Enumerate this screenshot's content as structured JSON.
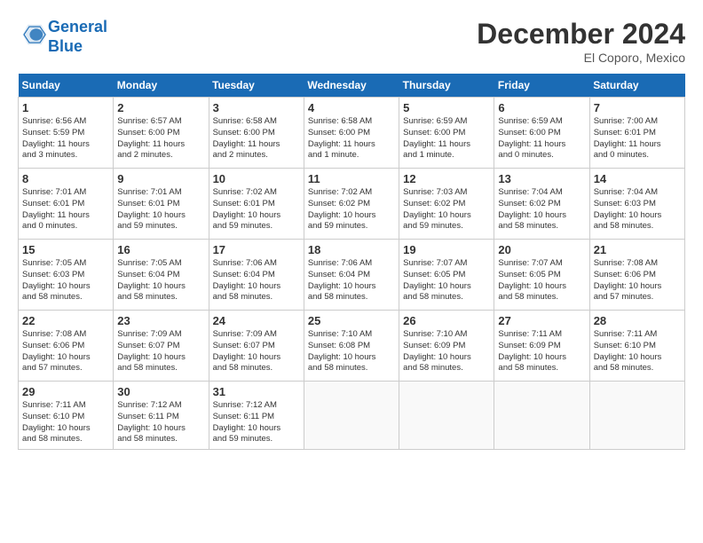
{
  "header": {
    "logo_line1": "General",
    "logo_line2": "Blue",
    "month": "December 2024",
    "location": "El Coporo, Mexico"
  },
  "weekdays": [
    "Sunday",
    "Monday",
    "Tuesday",
    "Wednesday",
    "Thursday",
    "Friday",
    "Saturday"
  ],
  "weeks": [
    [
      {
        "day": "1",
        "lines": [
          "Sunrise: 6:56 AM",
          "Sunset: 5:59 PM",
          "Daylight: 11 hours",
          "and 3 minutes."
        ]
      },
      {
        "day": "2",
        "lines": [
          "Sunrise: 6:57 AM",
          "Sunset: 6:00 PM",
          "Daylight: 11 hours",
          "and 2 minutes."
        ]
      },
      {
        "day": "3",
        "lines": [
          "Sunrise: 6:58 AM",
          "Sunset: 6:00 PM",
          "Daylight: 11 hours",
          "and 2 minutes."
        ]
      },
      {
        "day": "4",
        "lines": [
          "Sunrise: 6:58 AM",
          "Sunset: 6:00 PM",
          "Daylight: 11 hours",
          "and 1 minute."
        ]
      },
      {
        "day": "5",
        "lines": [
          "Sunrise: 6:59 AM",
          "Sunset: 6:00 PM",
          "Daylight: 11 hours",
          "and 1 minute."
        ]
      },
      {
        "day": "6",
        "lines": [
          "Sunrise: 6:59 AM",
          "Sunset: 6:00 PM",
          "Daylight: 11 hours",
          "and 0 minutes."
        ]
      },
      {
        "day": "7",
        "lines": [
          "Sunrise: 7:00 AM",
          "Sunset: 6:01 PM",
          "Daylight: 11 hours",
          "and 0 minutes."
        ]
      }
    ],
    [
      {
        "day": "8",
        "lines": [
          "Sunrise: 7:01 AM",
          "Sunset: 6:01 PM",
          "Daylight: 11 hours",
          "and 0 minutes."
        ]
      },
      {
        "day": "9",
        "lines": [
          "Sunrise: 7:01 AM",
          "Sunset: 6:01 PM",
          "Daylight: 10 hours",
          "and 59 minutes."
        ]
      },
      {
        "day": "10",
        "lines": [
          "Sunrise: 7:02 AM",
          "Sunset: 6:01 PM",
          "Daylight: 10 hours",
          "and 59 minutes."
        ]
      },
      {
        "day": "11",
        "lines": [
          "Sunrise: 7:02 AM",
          "Sunset: 6:02 PM",
          "Daylight: 10 hours",
          "and 59 minutes."
        ]
      },
      {
        "day": "12",
        "lines": [
          "Sunrise: 7:03 AM",
          "Sunset: 6:02 PM",
          "Daylight: 10 hours",
          "and 59 minutes."
        ]
      },
      {
        "day": "13",
        "lines": [
          "Sunrise: 7:04 AM",
          "Sunset: 6:02 PM",
          "Daylight: 10 hours",
          "and 58 minutes."
        ]
      },
      {
        "day": "14",
        "lines": [
          "Sunrise: 7:04 AM",
          "Sunset: 6:03 PM",
          "Daylight: 10 hours",
          "and 58 minutes."
        ]
      }
    ],
    [
      {
        "day": "15",
        "lines": [
          "Sunrise: 7:05 AM",
          "Sunset: 6:03 PM",
          "Daylight: 10 hours",
          "and 58 minutes."
        ]
      },
      {
        "day": "16",
        "lines": [
          "Sunrise: 7:05 AM",
          "Sunset: 6:04 PM",
          "Daylight: 10 hours",
          "and 58 minutes."
        ]
      },
      {
        "day": "17",
        "lines": [
          "Sunrise: 7:06 AM",
          "Sunset: 6:04 PM",
          "Daylight: 10 hours",
          "and 58 minutes."
        ]
      },
      {
        "day": "18",
        "lines": [
          "Sunrise: 7:06 AM",
          "Sunset: 6:04 PM",
          "Daylight: 10 hours",
          "and 58 minutes."
        ]
      },
      {
        "day": "19",
        "lines": [
          "Sunrise: 7:07 AM",
          "Sunset: 6:05 PM",
          "Daylight: 10 hours",
          "and 58 minutes."
        ]
      },
      {
        "day": "20",
        "lines": [
          "Sunrise: 7:07 AM",
          "Sunset: 6:05 PM",
          "Daylight: 10 hours",
          "and 58 minutes."
        ]
      },
      {
        "day": "21",
        "lines": [
          "Sunrise: 7:08 AM",
          "Sunset: 6:06 PM",
          "Daylight: 10 hours",
          "and 57 minutes."
        ]
      }
    ],
    [
      {
        "day": "22",
        "lines": [
          "Sunrise: 7:08 AM",
          "Sunset: 6:06 PM",
          "Daylight: 10 hours",
          "and 57 minutes."
        ]
      },
      {
        "day": "23",
        "lines": [
          "Sunrise: 7:09 AM",
          "Sunset: 6:07 PM",
          "Daylight: 10 hours",
          "and 58 minutes."
        ]
      },
      {
        "day": "24",
        "lines": [
          "Sunrise: 7:09 AM",
          "Sunset: 6:07 PM",
          "Daylight: 10 hours",
          "and 58 minutes."
        ]
      },
      {
        "day": "25",
        "lines": [
          "Sunrise: 7:10 AM",
          "Sunset: 6:08 PM",
          "Daylight: 10 hours",
          "and 58 minutes."
        ]
      },
      {
        "day": "26",
        "lines": [
          "Sunrise: 7:10 AM",
          "Sunset: 6:09 PM",
          "Daylight: 10 hours",
          "and 58 minutes."
        ]
      },
      {
        "day": "27",
        "lines": [
          "Sunrise: 7:11 AM",
          "Sunset: 6:09 PM",
          "Daylight: 10 hours",
          "and 58 minutes."
        ]
      },
      {
        "day": "28",
        "lines": [
          "Sunrise: 7:11 AM",
          "Sunset: 6:10 PM",
          "Daylight: 10 hours",
          "and 58 minutes."
        ]
      }
    ],
    [
      {
        "day": "29",
        "lines": [
          "Sunrise: 7:11 AM",
          "Sunset: 6:10 PM",
          "Daylight: 10 hours",
          "and 58 minutes."
        ]
      },
      {
        "day": "30",
        "lines": [
          "Sunrise: 7:12 AM",
          "Sunset: 6:11 PM",
          "Daylight: 10 hours",
          "and 58 minutes."
        ]
      },
      {
        "day": "31",
        "lines": [
          "Sunrise: 7:12 AM",
          "Sunset: 6:11 PM",
          "Daylight: 10 hours",
          "and 59 minutes."
        ]
      },
      null,
      null,
      null,
      null
    ]
  ]
}
